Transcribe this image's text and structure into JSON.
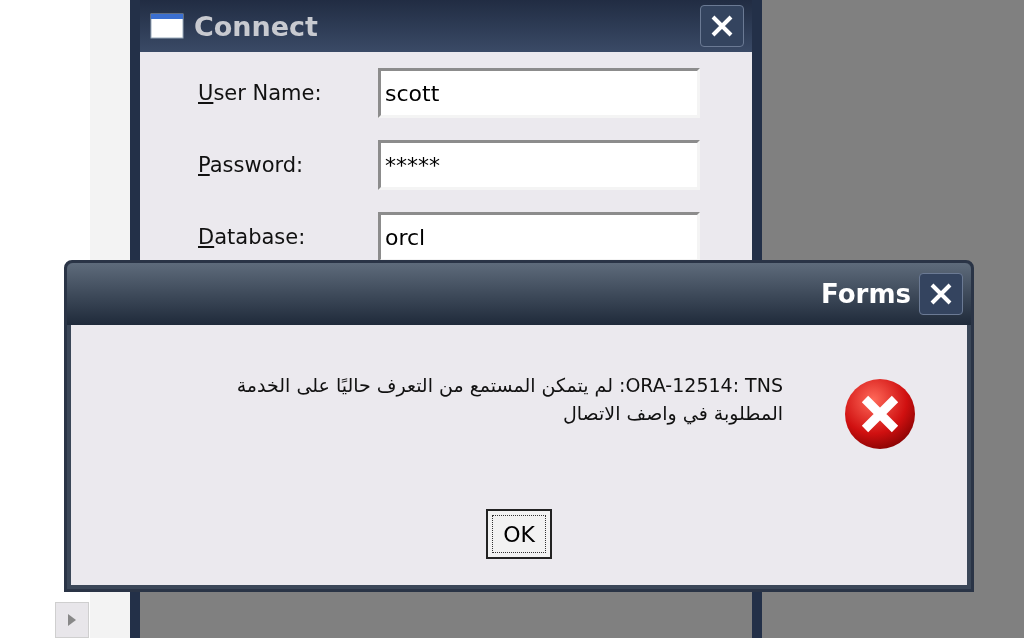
{
  "connect_window": {
    "title": "Connect",
    "fields": [
      {
        "label_underlined": "U",
        "label_rest": "ser Name:",
        "value": "scott"
      },
      {
        "label_underlined": "P",
        "label_rest": "assword:",
        "value": "*****"
      },
      {
        "label_underlined": "D",
        "label_rest": "atabase:",
        "value": "orcl"
      }
    ]
  },
  "alert": {
    "title": "Forms",
    "message": "ORA-12514: TNS: لم يتمكن المستمع من التعرف حاليًا على الخدمة المطلوبة في واصف الاتصال",
    "buttons": [
      "OK"
    ]
  }
}
